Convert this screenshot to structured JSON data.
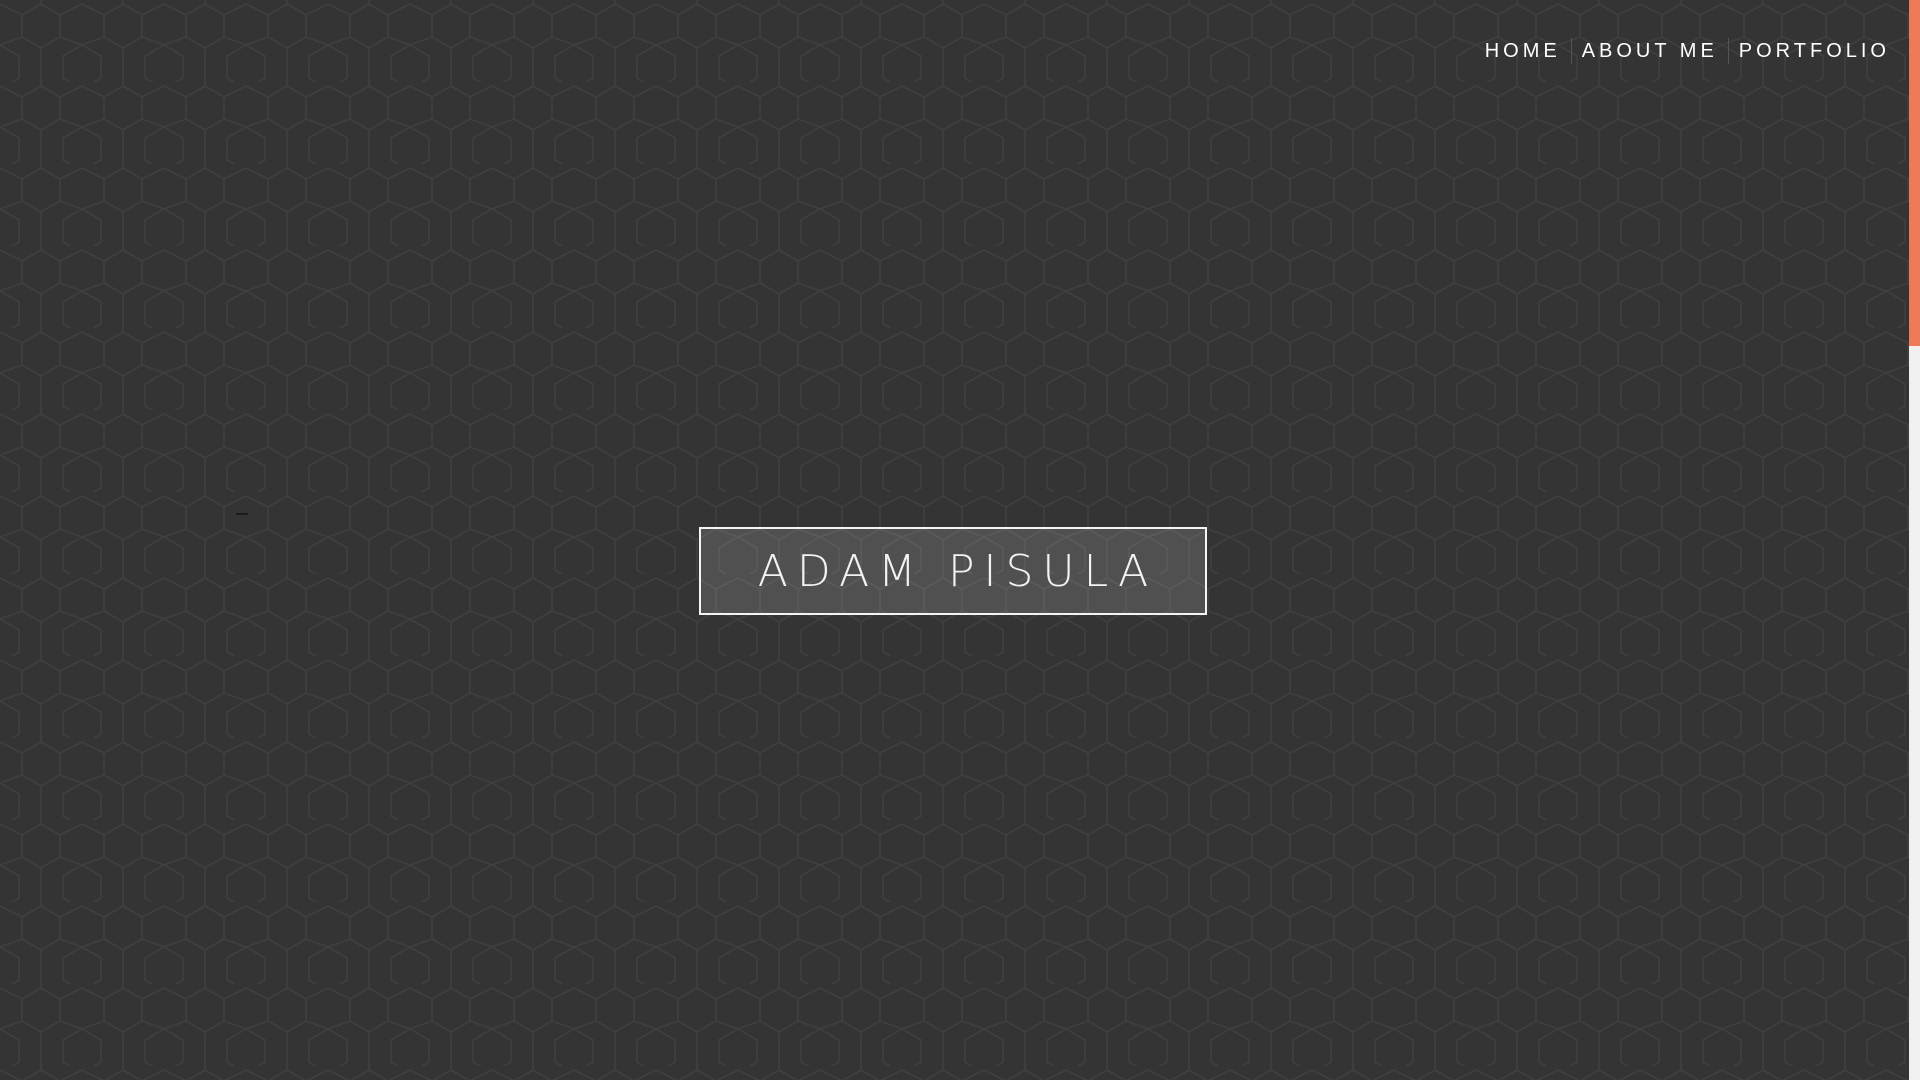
{
  "nav": {
    "items": [
      {
        "label": "HOME"
      },
      {
        "label": "ABOUT ME"
      },
      {
        "label": "PORTFOLIO"
      }
    ]
  },
  "hero": {
    "title": "ADAM PISULA"
  },
  "colors": {
    "background": "#343434",
    "pattern_line": "#3f3f3f",
    "scroll_thumb": "#ee7a5a",
    "scroll_track": "#f0f0f0",
    "text": "#ffffff"
  },
  "scrollbar": {
    "position_fraction": 0.0,
    "visible_fraction": 0.32
  }
}
